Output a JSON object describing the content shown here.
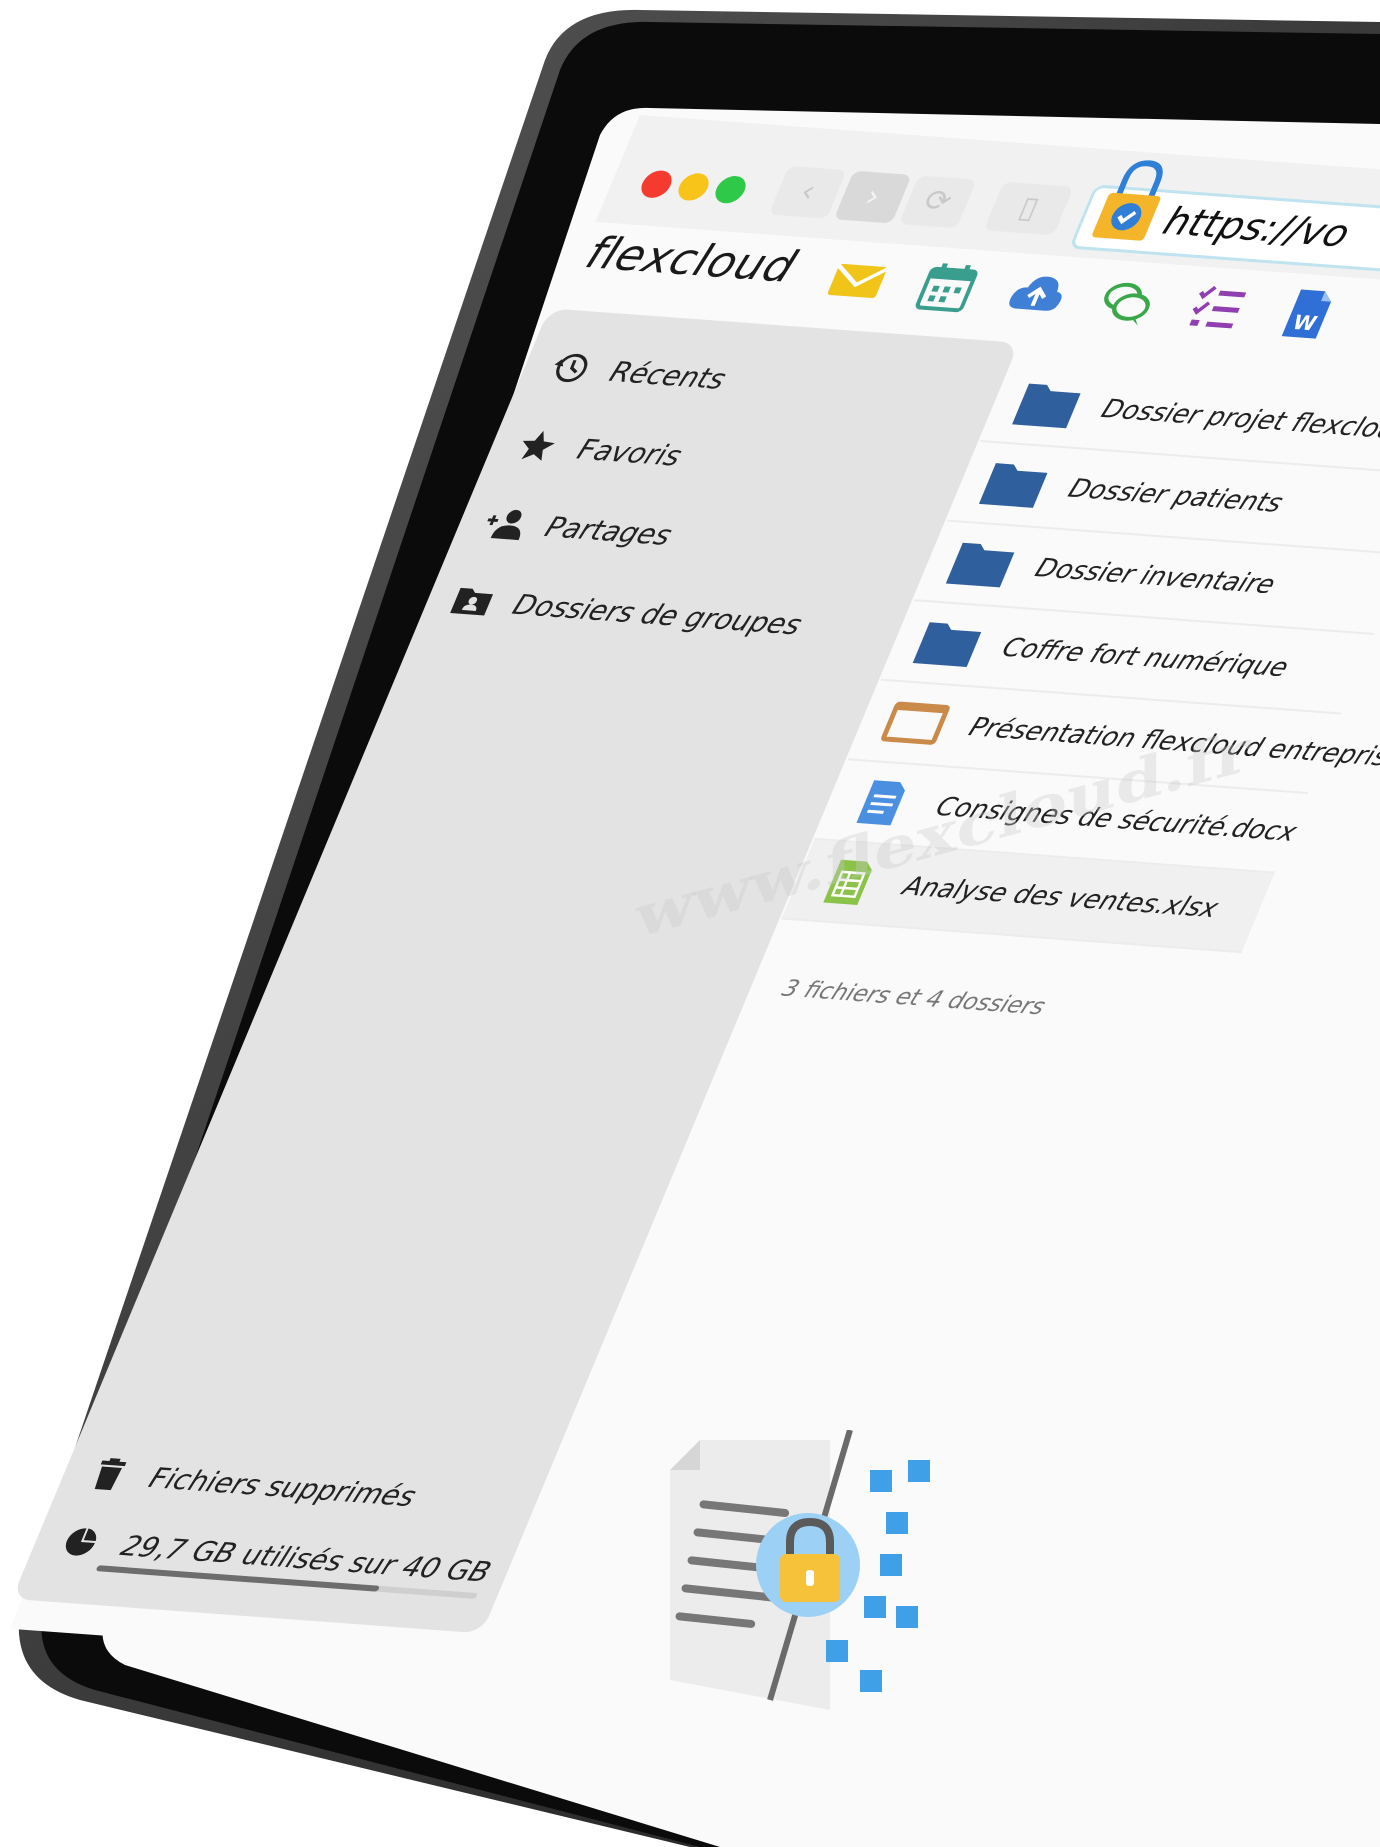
{
  "browser": {
    "url": "https://vo",
    "traffic_lights": [
      "#f53a2f",
      "#f8c41a",
      "#2fc94a"
    ]
  },
  "app": {
    "brand": "flexcloud",
    "apps": [
      {
        "name": "mail-icon",
        "color": "#f0c419"
      },
      {
        "name": "calendar-icon",
        "color": "#3a9e8e"
      },
      {
        "name": "cloud-upload-icon",
        "color": "#3f7fd6"
      },
      {
        "name": "chat-icon",
        "color": "#3aa84a"
      },
      {
        "name": "tasks-icon",
        "color": "#8f3fb0"
      },
      {
        "name": "word-document-icon",
        "color": "#2f6fd6"
      }
    ]
  },
  "sidebar": {
    "items": [
      {
        "label": "Récents",
        "icon": "history-icon"
      },
      {
        "label": "Favoris",
        "icon": "star-icon"
      },
      {
        "label": "Partages",
        "icon": "share-user-icon"
      },
      {
        "label": "Dossiers de groupes",
        "icon": "group-folder-icon"
      }
    ],
    "trash": {
      "label": "Fichiers supprimés",
      "icon": "trash-icon"
    },
    "storage": {
      "label": "29,7 GB utilisés sur 40 GB",
      "used_fraction": 0.7425
    }
  },
  "files": {
    "items": [
      {
        "name": "Dossier projet flexcloud",
        "type": "folder"
      },
      {
        "name": "Dossier patients",
        "type": "folder"
      },
      {
        "name": "Dossier inventaire",
        "type": "folder"
      },
      {
        "name": "Coffre fort numérique",
        "type": "folder"
      },
      {
        "name": "Présentation flexcloud entreprise.pptx",
        "type": "presentation"
      },
      {
        "name": "Consignes de sécurité.docx",
        "type": "document"
      },
      {
        "name": "Analyse des ventes.xlsx",
        "type": "spreadsheet"
      }
    ],
    "summary": "3 fichiers et 4 dossiers"
  },
  "watermark": "www.flexcloud.fr",
  "colors": {
    "folder": "#2f5f9c",
    "presentation": "#c98a4a",
    "document": "#4a8fe0",
    "spreadsheet": "#8bc34a",
    "sidebar_bg": "#e3e3e3"
  }
}
